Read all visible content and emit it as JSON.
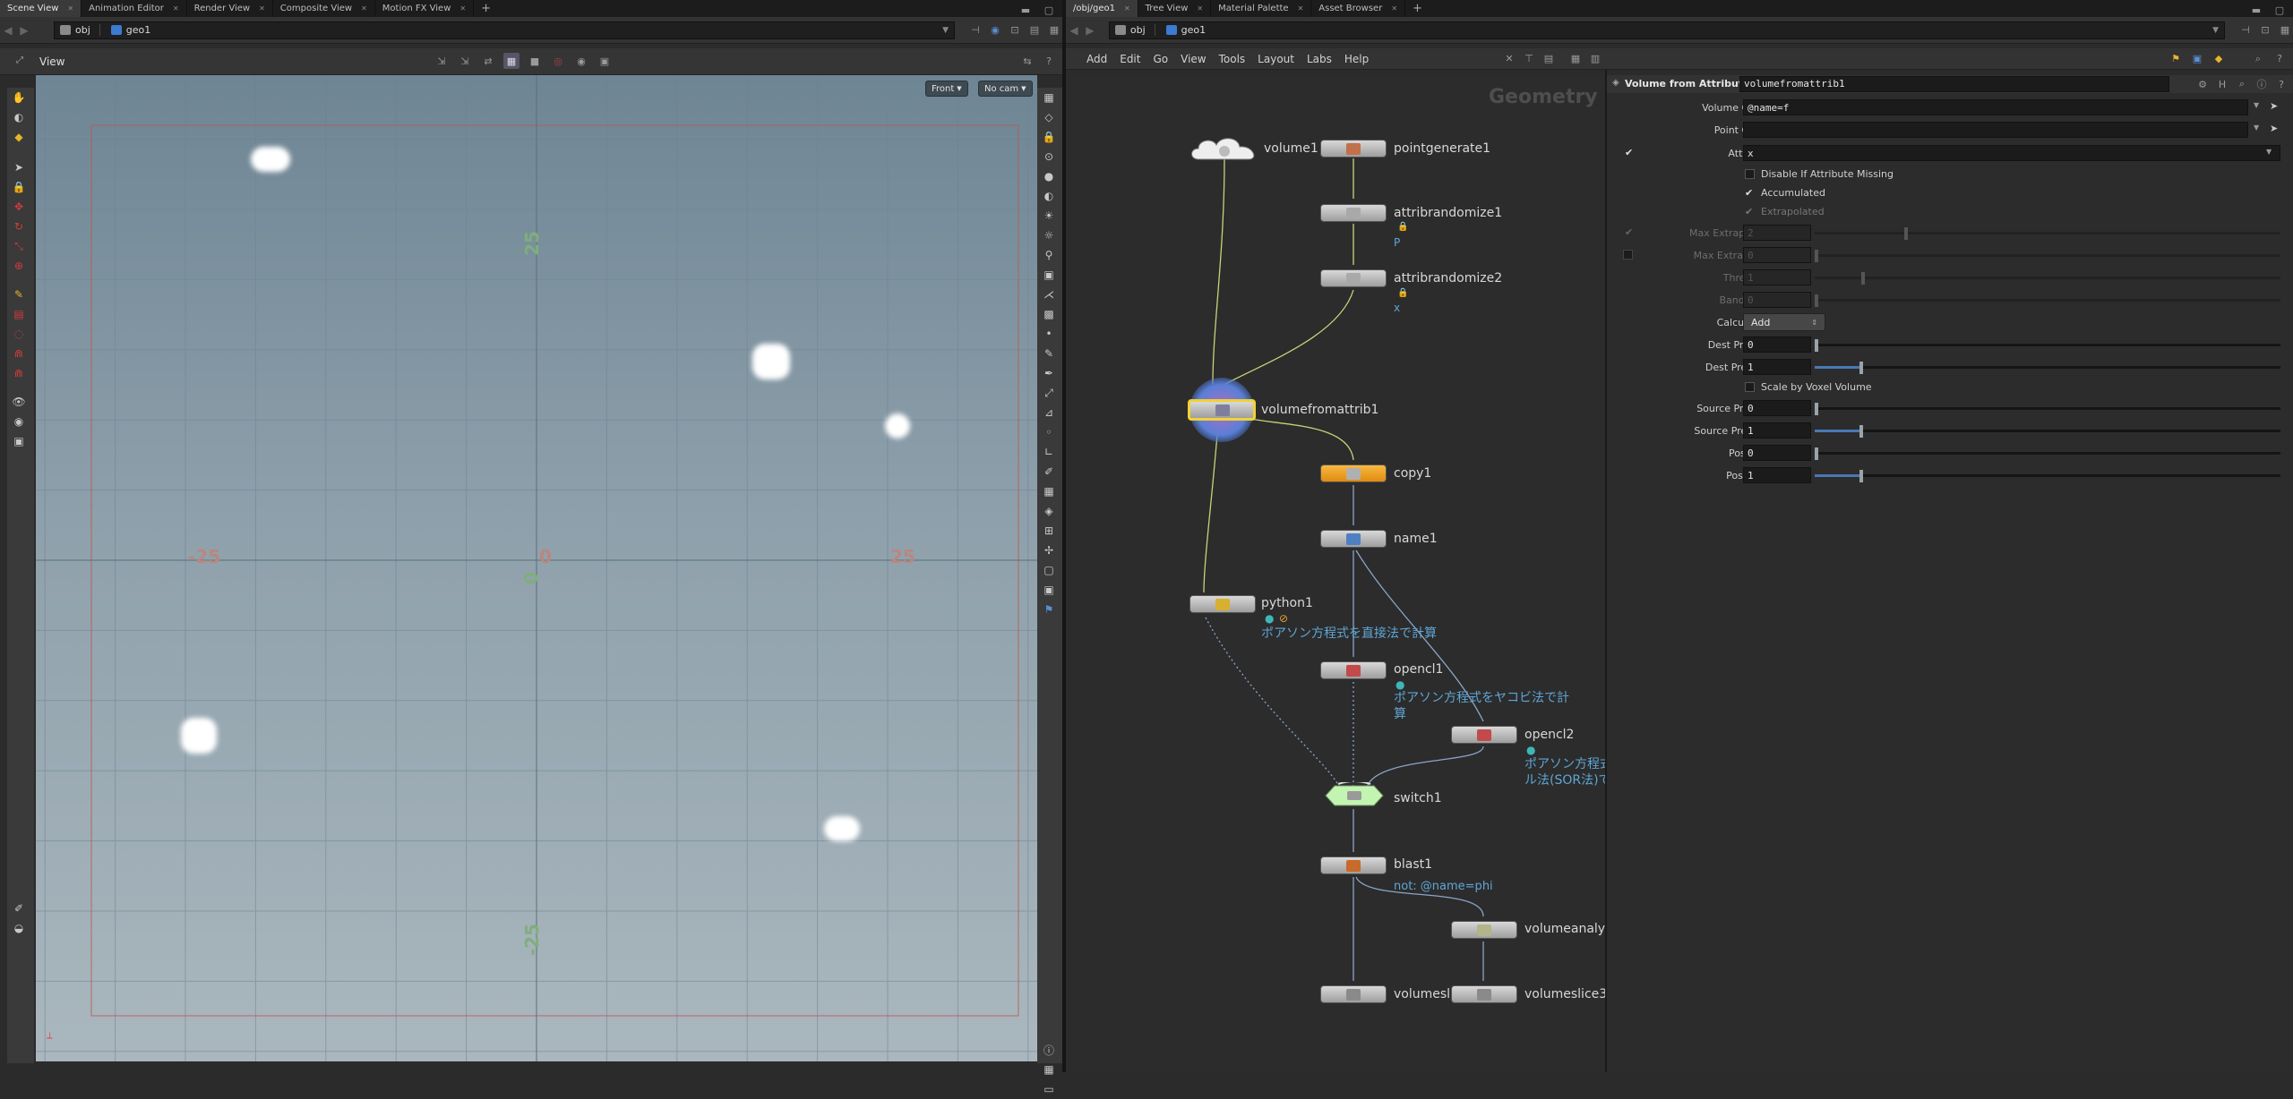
{
  "left_tabs": [
    {
      "label": "Scene View",
      "active": true
    },
    {
      "label": "Animation Editor",
      "active": false
    },
    {
      "label": "Render View",
      "active": false
    },
    {
      "label": "Composite View",
      "active": false
    },
    {
      "label": "Motion FX View",
      "active": false
    }
  ],
  "right_tabs": [
    {
      "label": "/obj/geo1",
      "active": true
    },
    {
      "label": "Tree View",
      "active": false
    },
    {
      "label": "Material Palette",
      "active": false
    },
    {
      "label": "Asset Browser",
      "active": false
    }
  ],
  "left_path": {
    "obj": "obj",
    "geo": "geo1"
  },
  "right_path": {
    "obj": "obj",
    "geo": "geo1"
  },
  "viewer": {
    "title": "View",
    "view_menu": "Front",
    "cam_menu": "No cam",
    "axis_labels": {
      "x_neg": "-25",
      "x_zero": "0",
      "x_pos": "25",
      "y_pos": "25",
      "y_zero": "0",
      "y_neg": "-25"
    }
  },
  "network": {
    "menus": [
      "Add",
      "Edit",
      "Go",
      "View",
      "Tools",
      "Layout",
      "Labs",
      "Help"
    ],
    "context_label": "Geometry",
    "nodes": {
      "volume1": "volume1",
      "pointgenerate1": "pointgenerate1",
      "attribrandomize1": "attribrandomize1",
      "attribrandomize1_flag": "P",
      "attribrandomize2": "attribrandomize2",
      "attribrandomize2_flag": "x",
      "volumefromattrib1": "volumefromattrib1",
      "copy1": "copy1",
      "name1": "name1",
      "python1": "python1",
      "python1_comment": "ポアソン方程式を直接法で計算",
      "opencl1": "opencl1",
      "opencl1_comment_1": "ポアソン方程式をヤコビ法で計",
      "opencl1_comment_2": "算",
      "opencl2": "opencl2",
      "opencl2_comment_1": "ポアソン方程式",
      "opencl2_comment_2": "ル法(SOR法)で",
      "switch1": "switch1",
      "blast1": "blast1",
      "blast1_comment": "not: @name=phi",
      "volumeanalysis": "volumeanalys",
      "volumeslice_left": "volumesli",
      "volumeslice3": "volumeslice3"
    }
  },
  "params": {
    "node_type": "Volume from Attribute",
    "node_name": "volumefromattrib1",
    "volume_group": {
      "label": "Volume Group",
      "value": "@name=f"
    },
    "point_group": {
      "label": "Point Group",
      "value": ""
    },
    "attribute": {
      "label": "Attribute",
      "value": "x"
    },
    "disable_missing": {
      "label": "Disable If Attribute Missing",
      "checked": false
    },
    "accumulated": {
      "label": "Accumulated",
      "checked": true
    },
    "extrapolated": {
      "label": "Extrapolated",
      "checked": true
    },
    "max_extrap_cells": {
      "label": "Max Extrap Cells",
      "value": "2"
    },
    "max_extrap_dist": {
      "label": "Max Extrap Dist",
      "value": "0"
    },
    "threshold": {
      "label": "Threshold",
      "value": "1"
    },
    "bandwidth": {
      "label": "Bandwidth",
      "value": "0"
    },
    "calculation": {
      "label": "Calculation",
      "value": "Add"
    },
    "dest_pre_add": {
      "label": "Dest Pre-Add",
      "value": "0"
    },
    "dest_pre_mult": {
      "label": "Dest Pre-Mult",
      "value": "1"
    },
    "scale_voxel": {
      "label": "Scale by Voxel Volume",
      "checked": false
    },
    "source_pre_add": {
      "label": "Source Pre-Add",
      "value": "0"
    },
    "source_pre_mult": {
      "label": "Source Pre-Mult",
      "value": "1"
    },
    "post_add": {
      "label": "Post-Add",
      "value": "0"
    },
    "post_mult": {
      "label": "Post-Mult",
      "value": "1"
    }
  },
  "colors": {
    "copy_node": "#f0a21a",
    "switch_node": "#b9f2a8",
    "selected_outline": "#f2d233",
    "wire": "#c9d27a",
    "comment": "#5fa6d6"
  }
}
